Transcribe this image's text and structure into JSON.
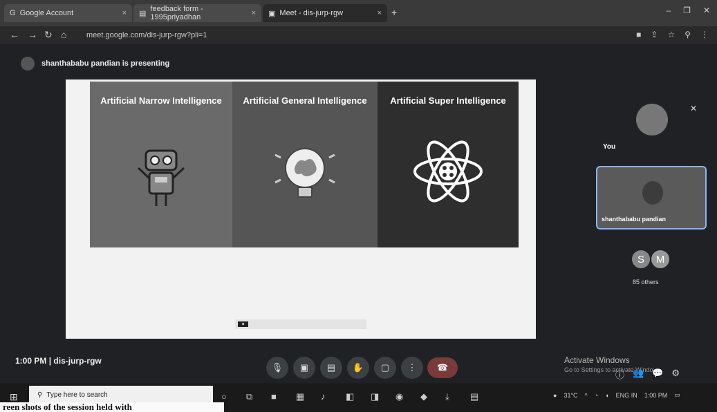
{
  "browser": {
    "tabs": [
      {
        "label": "Google Account",
        "icon": "google-icon"
      },
      {
        "label": "feedback form - 1995priyadhan",
        "icon": "doc-icon"
      },
      {
        "label": "Meet - dis-jurp-rgw",
        "icon": "meet-icon"
      }
    ],
    "url": "meet.google.com/dis-jurp-rgw?pli=1"
  },
  "meet": {
    "presenting_text": "shanthababu pandian is presenting",
    "slide": {
      "panels": [
        {
          "title": "Artificial Narrow Intelligence",
          "icon": "robot-icon"
        },
        {
          "title": "Artificial General Intelligence",
          "icon": "lightbulb-brain-icon"
        },
        {
          "title": "Artificial Super Intelligence",
          "icon": "atom-icon"
        }
      ]
    },
    "you_label": "You",
    "presenter_name": "shanthababu pandian",
    "participant_chips": [
      "S",
      "M"
    ],
    "others_count": "85 others",
    "meeting_time": "1:00 PM",
    "meeting_code": "dis-jurp-rgw",
    "activate_windows_title": "Activate Windows",
    "activate_windows_sub": "Go to Settings to activate Windows."
  },
  "taskbar": {
    "search_placeholder": "Type here to search",
    "temperature": "31°C",
    "language": "ENG",
    "region": "IN",
    "clock": "1:00 PM"
  },
  "caption": "reen shots of the session held with"
}
